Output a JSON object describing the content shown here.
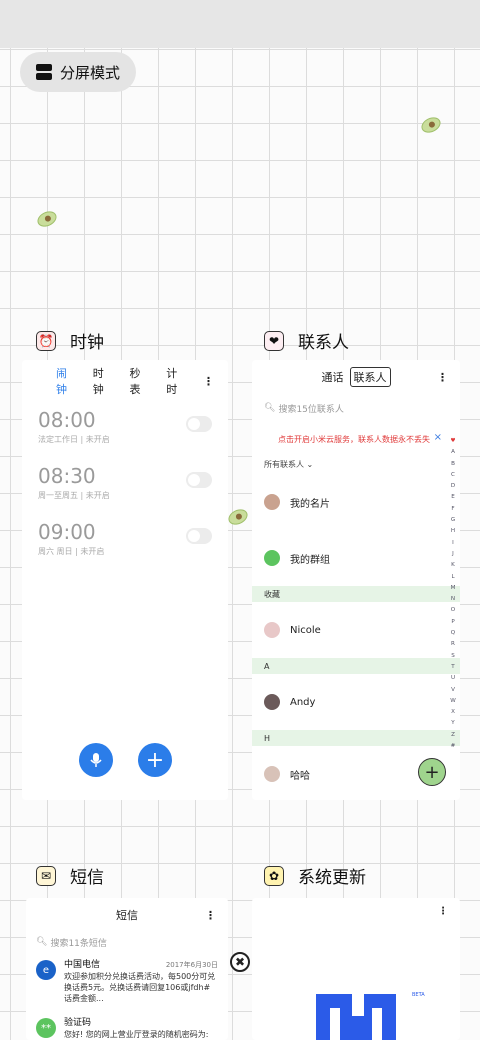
{
  "recents": {
    "split_mode_label": "分屏模式"
  },
  "clock_app": {
    "title": "时钟",
    "tabs": [
      "闹钟",
      "时钟",
      "秒表",
      "计时"
    ],
    "more": "⋮",
    "alarms": [
      {
        "time": "08:00",
        "desc": "法定工作日 | 未开启",
        "enabled": false
      },
      {
        "time": "08:30",
        "desc": "周一至周五 | 未开启",
        "enabled": false
      },
      {
        "time": "09:00",
        "desc": "周六 周日 | 未开启",
        "enabled": false
      }
    ],
    "add_symbol": "+"
  },
  "contacts_app": {
    "title": "联系人",
    "tabs": [
      "通话",
      "联系人"
    ],
    "more": "⋮",
    "search_placeholder": "搜索15位联系人",
    "banner": "点击开启小米云服务，联系人数据永不丢失",
    "banner_close": "×",
    "all_contacts": "所有联系人",
    "my_card": "我的名片",
    "my_groups": "我的群组",
    "section_favorites": "收藏",
    "contact_nicole": "Nicole",
    "section_a": "A",
    "contact_andy": "Andy",
    "section_h": "H",
    "contact_haha": "哈哈",
    "add_symbol": "+",
    "alphabet": [
      "♥",
      "A",
      "B",
      "C",
      "D",
      "E",
      "F",
      "G",
      "H",
      "I",
      "J",
      "K",
      "L",
      "M",
      "N",
      "O",
      "P",
      "Q",
      "R",
      "S",
      "T",
      "U",
      "V",
      "W",
      "X",
      "Y",
      "Z",
      "#"
    ]
  },
  "sms_app": {
    "title": "短信",
    "header": "短信",
    "more": "⋮",
    "search_placeholder": "搜索11条短信",
    "messages": [
      {
        "sender": "中国电信",
        "date": "2017年6月30日",
        "preview": "欢迎参加积分兑换话费活动，每500分可兑换话费5元。兑换话费请回复106或jfdh#话费金额..."
      },
      {
        "sender": "验证码",
        "date": "",
        "preview": "您好! 您的网上营业厅登录的随机密码为:"
      }
    ],
    "close_symbol": "✖"
  },
  "update_app": {
    "title": "系统更新",
    "more": "⋮",
    "beta_label": "BETA"
  },
  "colors": {
    "accent": "#2b7de9",
    "banner_red": "#e03a3a",
    "section_green": "#e6f4e6",
    "fab_green": "#9fd48d",
    "update_blue": "#2b5be8"
  }
}
